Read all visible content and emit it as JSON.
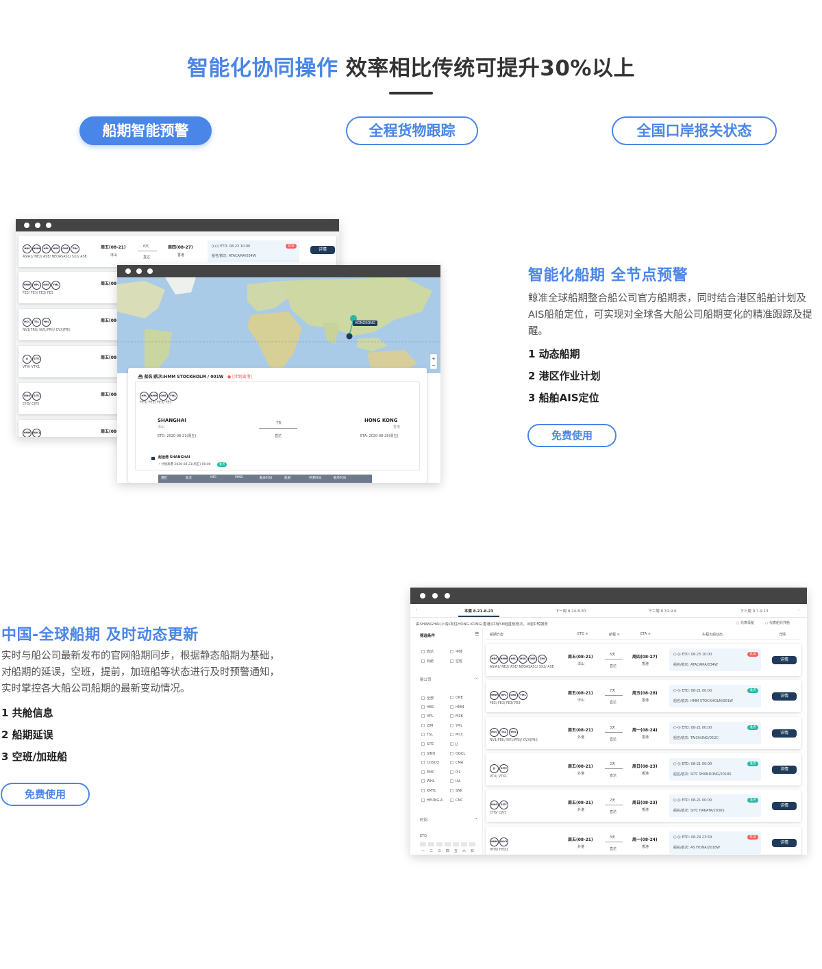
{
  "header": {
    "title_blue": "智能化协同操作",
    "title_dark": "效率相比传统可提升30%以上"
  },
  "tabs": [
    {
      "label": "船期智能预警",
      "active": true
    },
    {
      "label": "全程货物跟踪",
      "active": false
    },
    {
      "label": "全国口岸报关状态",
      "active": false
    }
  ],
  "section1": {
    "title": "智能化船期  全节点预警",
    "desc": "鲸准全球船期整合船公司官方船期表，同时结合港区船舶计划及AIS船舶定位，可实现对全球各大船公司船期变化的精准跟踪及提醒。",
    "features": [
      "1  动态船期",
      "2  港区作业计划",
      "3  船舶AIS定位"
    ],
    "button": "免费使用"
  },
  "section2": {
    "title": "中国-全球船期    及时动态更新",
    "desc": "实时与船公司最新发布的官网船期同步，根据静态船期为基础，对船期的延误，空班，提前，加班船等状态进行及时预警通知，实时掌控各大船公司船期的最新变动情况。",
    "features": [
      "1  共舱信息",
      "2  船期延误",
      "3  空班/加班船"
    ],
    "button": "免费使用"
  },
  "mock1": {
    "rows": [
      {
        "carriers": [
          "HBS",
          "HMM",
          "HPL",
          "MSK",
          "ONE",
          "ZIM"
        ],
        "services": "ASIA1/ NE2/ ASE/ NEOASAS1/ SX2/ ASE",
        "etd": "周五(08-21)",
        "port": "洋山",
        "days": "6天",
        "mode": "直达",
        "eta": "周四(08-27)",
        "dest": "香港",
        "info1": "((•)) ETD: 08-23 10:00",
        "info2": "船名/航次: ATACAMA/034W",
        "badge": "延误",
        "btn": "详情"
      },
      {
        "carriers": [
          "HMM",
          "HPL",
          "ONE",
          "YML"
        ],
        "services": "FE3/ FE3/ FE3/ FE3",
        "etd": "周五(08-"
      },
      {
        "carriers": [
          "MCC",
          "TSL",
          "YML"
        ],
        "services": "NV1(FRI)/ NV1(FRI)/ CVX(FRI)",
        "etd": "周五(08-"
      },
      {
        "carriers": [
          "JJ",
          "SITC"
        ],
        "services": "VTX/ VTX1",
        "etd": "周五(08-"
      },
      {
        "carriers": [
          "SINO",
          "SITC"
        ],
        "services": "CHS/ CJV5",
        "etd": "周五(08-"
      },
      {
        "carriers": [
          "HMM",
          "OOCL"
        ],
        "services": "",
        "etd": "周五(08-"
      }
    ]
  },
  "map": {
    "hk_label": "HONGKONG",
    "vessel_title": "船名/航次:HMM STOCKHOLM / 001W",
    "vessel_status": "● [计划离港]",
    "carriers": [
      "HPL",
      "HMM",
      "ONE",
      "YML"
    ],
    "services": "FE3/ FE3/ FE3/ FE3",
    "origin": "SHANGHAI",
    "origin_port": "洋山",
    "dest": "HONG KONG",
    "dest_port": "香港",
    "days": "7天",
    "mode": "直达",
    "etd": "ETD: 2020-08-21(周五)",
    "eta": "ETA: 2020-08-28(周五)",
    "timeline_title": "起运港 SHANGHAI",
    "timeline_item": "• 计划离港  2020-08-21(周五) 00:00",
    "timeline_badge": "准点",
    "table_headers": [
      "港区",
      "航次",
      "IMO",
      "MMSI",
      "截关时间",
      "船期",
      "开港时间",
      "截单时间"
    ]
  },
  "mock2": {
    "weeks": [
      "本周 8.21-8.23",
      "下一周 8.24-8.30",
      "下二周 8.31-9.6",
      "下三周 9.7-9.13"
    ],
    "route_note": "由SHANGHAI(上海)发往HONG KONG(香港)共有58组直航班次，0组中转服务",
    "legend": [
      "代表母船",
      "代表船代共舱"
    ],
    "filter_title": "筛选条件",
    "filter_opts": [
      [
        "直达",
        "中转"
      ],
      [
        "有舱",
        "空班"
      ]
    ],
    "carrier_title": "船公司",
    "carriers_grid": [
      [
        "全部",
        "ONE"
      ],
      [
        "HBS",
        "HMM"
      ],
      [
        "HPL",
        "MSK"
      ],
      [
        "ZIM",
        "YML"
      ],
      [
        "TSL",
        "MCC"
      ],
      [
        "SITC",
        "JJ"
      ],
      [
        "SINO",
        "OOCL"
      ],
      [
        "COSCO",
        "CMA"
      ],
      [
        "EMC",
        "PIL"
      ],
      [
        "WHL",
        "IAL"
      ],
      [
        "KMTC",
        "SNK"
      ],
      [
        "HEUNG-A",
        "CNC"
      ]
    ],
    "time_title": "时间",
    "etd_label": "ETD",
    "weekdays": [
      "一",
      "二",
      "三",
      "四",
      "五",
      "六",
      "日"
    ],
    "col_headers": [
      "船期方案",
      "ETD ≑",
      "航程 ≑",
      "ETA ≑",
      "头程大船动态",
      "详情"
    ],
    "rows": [
      {
        "carriers": [
          "HBS",
          "HMM",
          "HPL",
          "MSK",
          "ONE",
          "ZIM"
        ],
        "services": "ASIA1/ NE2/ ASE/ NEOASAS1/ SX2/ ASE",
        "etd": "周五(08-21)",
        "port": "洋山",
        "days": "6天",
        "mode": "直达",
        "eta": "周四(08-27)",
        "dest": "香港",
        "info1": "((•)) ETD: 08-23 10:00",
        "info2": "船名/航次: ATACAMA/034W",
        "badge": "延误",
        "badge_color": "#f0615a",
        "btn": "详情"
      },
      {
        "carriers": [
          "HMM",
          "HPL",
          "ONE",
          "YML"
        ],
        "services": "FE3/ FE3/ FE3/ FE3",
        "etd": "周五(08-21)",
        "port": "洋山",
        "days": "7天",
        "mode": "直达",
        "eta": "周五(08-28)",
        "dest": "香港",
        "info1": "((•)) ETD: 08-21 00:00",
        "info2": "船名/航次: HMM STOCKHOLM/001W",
        "badge": "准点",
        "badge_color": "#2bb7a3",
        "btn": "详情"
      },
      {
        "carriers": [
          "MCC",
          "TSL",
          "YML"
        ],
        "services": "NV1(FRI)/ NV1(FRI)/ CVX(FRI)",
        "etd": "周五(08-21)",
        "port": "外港",
        "days": "3天",
        "mode": "直达",
        "eta": "周一(08-24)",
        "dest": "香港",
        "info1": "((•)) ETD: 08-21 00:00",
        "info2": "船名/航次: TAICHUNG/052C",
        "badge": "准点",
        "badge_color": "#2bb7a3",
        "btn": "详情"
      },
      {
        "carriers": [
          "JJ",
          "SITC"
        ],
        "services": "VTX/ VTX1",
        "etd": "周五(08-21)",
        "port": "外港",
        "days": "2天",
        "mode": "直达",
        "eta": "周日(08-23)",
        "dest": "香港",
        "info1": "((•)) ETD: 08-21 00:00",
        "info2": "船名/航次: SITC SHANDONG/2018S",
        "badge": "准点",
        "badge_color": "#2bb7a3",
        "btn": "详情"
      },
      {
        "carriers": [
          "SINO",
          "SITC"
        ],
        "services": "CHS/ CJV5",
        "etd": "周五(08-21)",
        "port": "外港",
        "days": "2天",
        "mode": "直达",
        "eta": "周日(08-23)",
        "dest": "香港",
        "info1": "((•)) ETD: 08-21 00:00",
        "info2": "船名/航次: SITC HAKATA/2036S",
        "badge": "准点",
        "badge_color": "#2bb7a3",
        "btn": "详情"
      },
      {
        "carriers": [
          "HMM",
          "OOCL"
        ],
        "services": "HHX/ HHX1",
        "etd": "周五(08-21)",
        "port": "外港",
        "days": "3天",
        "mode": "直达",
        "eta": "周一(08-24)",
        "dest": "香港",
        "info1": "((•)) ETD: 08-24 23:59",
        "info2": "船名/航次: AS FIONA/2018W",
        "badge": "延误",
        "badge_color": "#f0615a",
        "btn": "详情"
      }
    ]
  }
}
